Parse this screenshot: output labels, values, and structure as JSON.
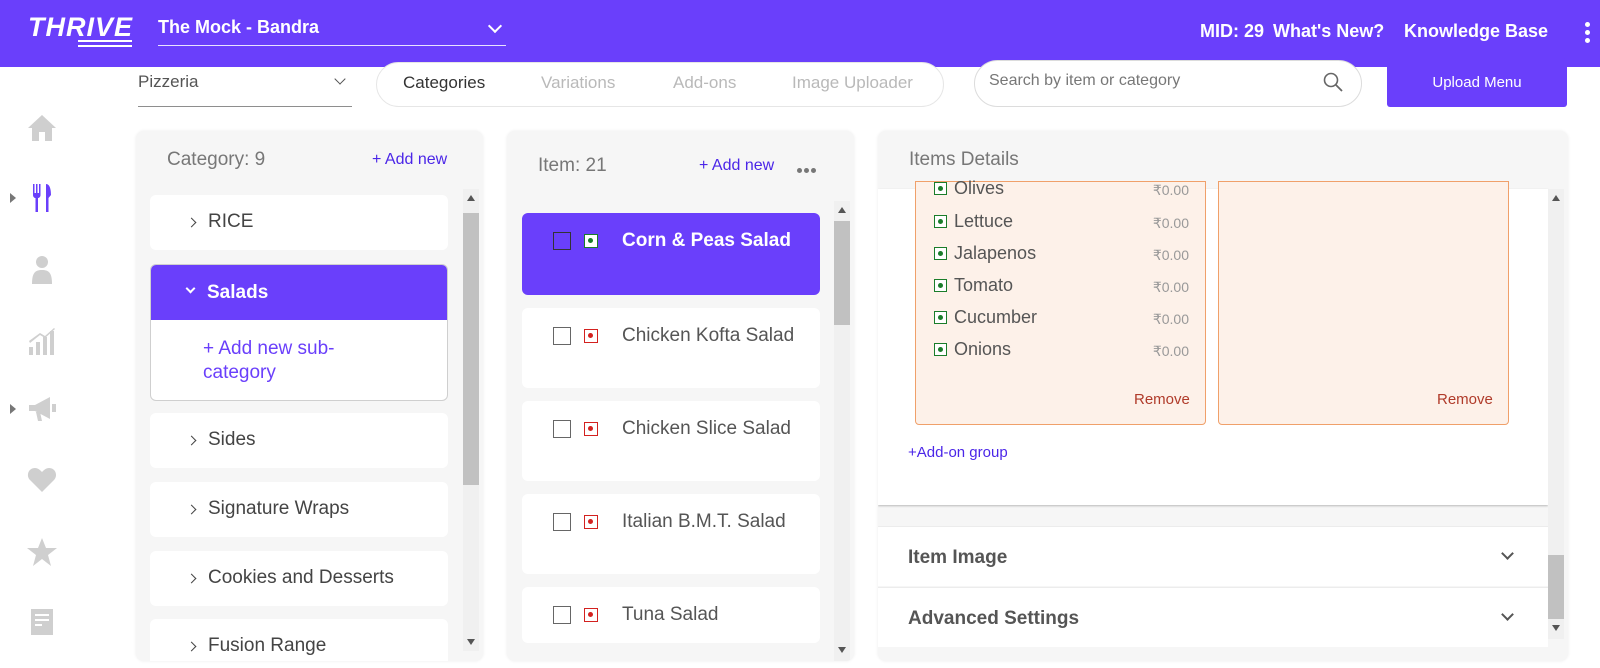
{
  "header": {
    "logo": "THRIVE",
    "outlet": "The Mock - Bandra",
    "mid": "MID: 29",
    "whats_new": "What's New?",
    "knowledge_base": "Knowledge Base",
    "brand_color": "#6a3ffb"
  },
  "sidebar": {
    "icons": [
      "home-icon",
      "cutlery-icon",
      "user-icon",
      "growth-chart-icon",
      "megaphone-icon",
      "heart-icon",
      "star-icon",
      "receipt-icon"
    ]
  },
  "toolbar": {
    "brand": "Pizzeria",
    "tabs": [
      "Categories",
      "Variations",
      "Add-ons",
      "Image Uploader"
    ],
    "active_tab": "Categories",
    "search_placeholder": "Search by item or category",
    "upload_label": "Upload Menu"
  },
  "categories": {
    "title": "Category: 9",
    "add_new": "+ Add new",
    "items": [
      "RICE",
      "Salads",
      "Sides",
      "Signature Wraps",
      "Cookies and Desserts",
      "Fusion Range"
    ],
    "expanded": "Salads",
    "add_sub": "+ Add new sub-category"
  },
  "items": {
    "title": "Item: 21",
    "add_new": "+ Add new",
    "list": [
      {
        "name": "Corn & Peas Salad",
        "type": "veg",
        "active": true
      },
      {
        "name": "Chicken Kofta Salad",
        "type": "nonveg"
      },
      {
        "name": "Chicken Slice Salad",
        "type": "nonveg"
      },
      {
        "name": "Italian B.M.T. Salad",
        "type": "nonveg"
      },
      {
        "name": "Tuna Salad",
        "type": "nonveg"
      }
    ]
  },
  "details": {
    "title": "Items Details",
    "addons": [
      {
        "name": "Olives",
        "price": "₹0.00"
      },
      {
        "name": "Lettuce",
        "price": "₹0.00"
      },
      {
        "name": "Jalapenos",
        "price": "₹0.00"
      },
      {
        "name": "Tomato",
        "price": "₹0.00"
      },
      {
        "name": "Cucumber",
        "price": "₹0.00"
      },
      {
        "name": "Onions",
        "price": "₹0.00"
      }
    ],
    "remove": "Remove",
    "add_group": "+Add-on group",
    "item_image": "Item Image",
    "advanced": "Advanced Settings"
  }
}
